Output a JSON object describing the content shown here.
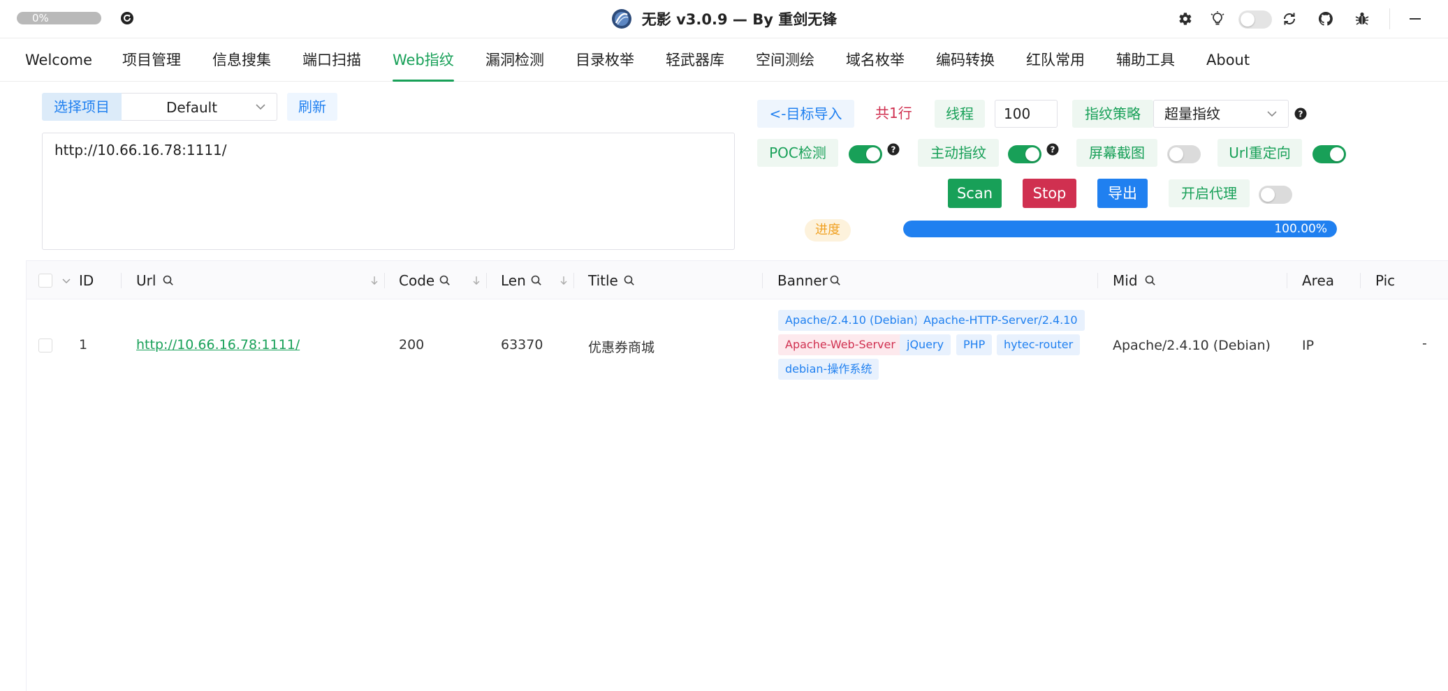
{
  "titlebar": {
    "update_progress": "0%",
    "title": "无影 v3.0.9 — By 重剑无锋"
  },
  "icons": {
    "reload": "reload-icon",
    "logo": "app-logo",
    "settings": "gear-icon",
    "tips": "lightbulb-icon",
    "theme": "theme-toggle",
    "refresh": "refresh-icon",
    "github": "github-icon",
    "debug": "bug-icon",
    "minimize": "minimize-icon"
  },
  "nav": {
    "tabs": [
      "Welcome",
      "项目管理",
      "信息搜集",
      "端口扫描",
      "Web指纹",
      "漏洞检测",
      "目录枚举",
      "轻武器库",
      "空间测绘",
      "域名枚举",
      "编码转换",
      "红队常用",
      "辅助工具",
      "About"
    ],
    "active": "Web指纹"
  },
  "left": {
    "select_label": "选择项目",
    "project": "Default",
    "refresh_label": "刷新",
    "targets": "http://10.66.16.78:1111/"
  },
  "right": {
    "import_label": "<-目标导入",
    "line_count": "共1行",
    "threads_label": "线程",
    "threads_value": "100",
    "strategy_label": "指纹策略",
    "strategy_value": "超量指纹",
    "poc_label": "POC检测",
    "poc_on": true,
    "active_fp_label": "主动指纹",
    "active_fp_on": true,
    "screenshot_label": "屏幕截图",
    "screenshot_on": false,
    "redirect_label": "Url重定向",
    "redirect_on": true,
    "scan_label": "Scan",
    "stop_label": "Stop",
    "export_label": "导出",
    "proxy_label": "开启代理",
    "proxy_on": false,
    "progress_label": "进度",
    "progress_text": "100.00%",
    "progress_value": 1.0
  },
  "colors": {
    "primary_green": "#18a058",
    "info_blue": "#2080f0",
    "error_red": "#d03050",
    "warning_orange": "#f0a020"
  },
  "table": {
    "columns": [
      "ID",
      "Url",
      "Code",
      "Len",
      "Title",
      "Banner",
      "Mid",
      "Area",
      "Pic"
    ],
    "rows": [
      {
        "id": "1",
        "url": "http://10.66.16.78:1111/",
        "code": "200",
        "len": "63370",
        "title": "优惠券商城",
        "banner": [
          "Apache/2.4.10 (Debian)",
          "Apache-HTTP-Server/2.4.10",
          "Apache-Web-Server",
          "jQuery",
          "PHP",
          "hytec-router",
          "debian-操作系统"
        ],
        "mid": "Apache/2.4.10 (Debian)",
        "area": "IP",
        "pic": "-"
      }
    ]
  }
}
